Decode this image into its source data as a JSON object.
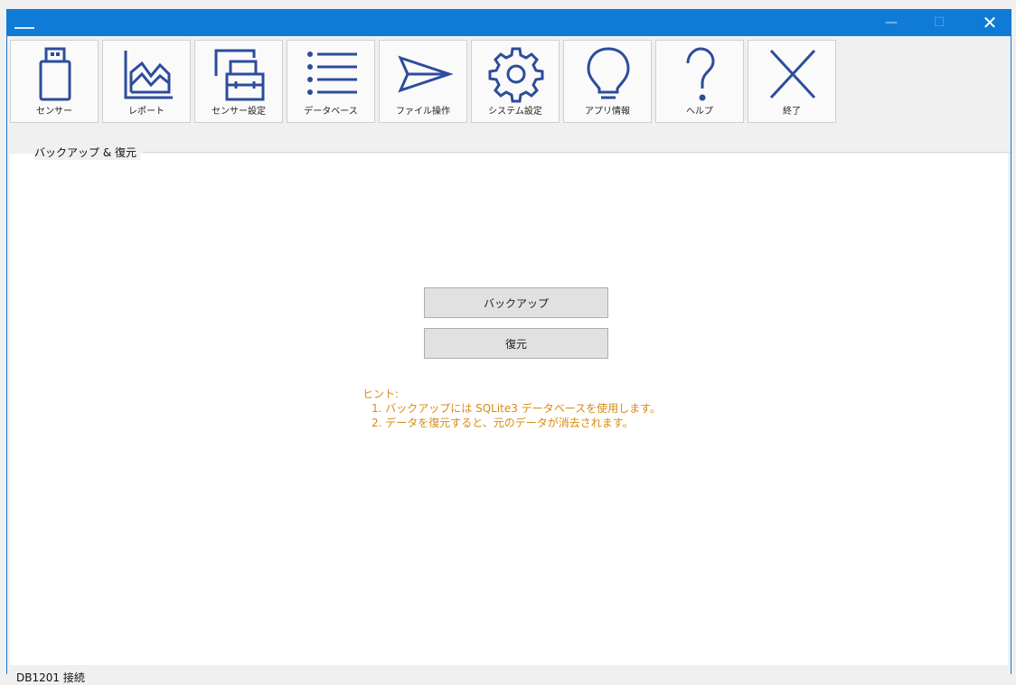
{
  "window": {
    "title": "",
    "controls": {
      "minimize": "—",
      "maximize": "☐",
      "close": "✕"
    }
  },
  "toolbar": {
    "buttons": [
      {
        "label": "センサー",
        "icon": "usb-drive-icon"
      },
      {
        "label": "レポート",
        "icon": "area-chart-icon"
      },
      {
        "label": "センサー設定",
        "icon": "sensor-settings-icon"
      },
      {
        "label": "データベース",
        "icon": "list-icon"
      },
      {
        "label": "ファイル操作",
        "icon": "send-icon"
      },
      {
        "label": "システム設定",
        "icon": "gear-icon"
      },
      {
        "label": "アプリ情報",
        "icon": "lightbulb-icon"
      },
      {
        "label": "ヘルプ",
        "icon": "question-icon"
      },
      {
        "label": "終了",
        "icon": "close-x-icon"
      }
    ],
    "icon_color": "#2c4d9c"
  },
  "panel": {
    "title": "バックアップ & 復元",
    "backup_label": "バックアップ",
    "restore_label": "復元",
    "hint": {
      "heading": "ヒント:",
      "line1": "1. バックアップには SQLite3 データベースを使用します。",
      "line2": "2. データを復元すると、元のデータが消去されます。"
    },
    "hint_color": "#d88a12"
  },
  "status": {
    "text": "DB1201 接続"
  },
  "colors": {
    "titlebar": "#0f7bd7",
    "accent": "#1979ca"
  }
}
